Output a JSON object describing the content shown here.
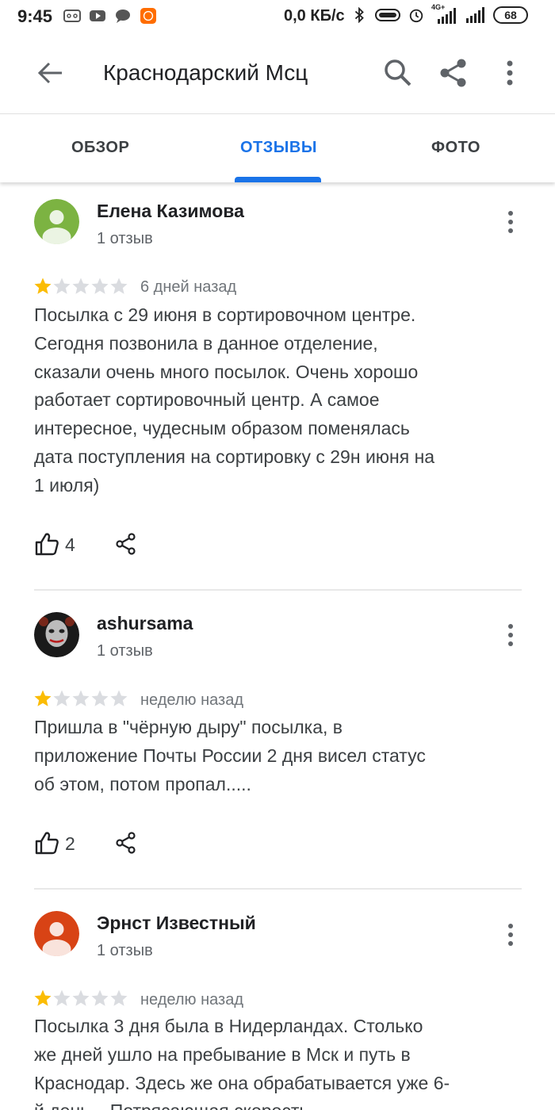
{
  "status_bar": {
    "time": "9:45",
    "speed": "0,0 КБ/с",
    "network": "4G+",
    "battery": "68",
    "icons": [
      "voicemail-icon",
      "youtube-icon",
      "chat-icon",
      "app-icon",
      "bluetooth-icon",
      "vibrate-icon",
      "alarm-icon",
      "signal-icon",
      "signal-icon",
      "battery-icon"
    ]
  },
  "app_bar": {
    "title": "Краснодарский Мсц",
    "icons": [
      "back-arrow-icon",
      "search-icon",
      "share-icon",
      "more-vert-icon"
    ]
  },
  "tabs": [
    {
      "label": "ОБЗОР",
      "active": false
    },
    {
      "label": "ОТЗЫВЫ",
      "active": true
    },
    {
      "label": "ФОТО",
      "active": false
    }
  ],
  "colors": {
    "accent": "#1a73e8",
    "star_filled": "#fbbc04",
    "star_empty": "#dadce0"
  },
  "reviews": [
    {
      "author": "Елена Казимова",
      "count": "1 отзыв",
      "rating": 1,
      "max_rating": 5,
      "date": "6 дней назад",
      "lines": [
        "Посылка с 29 июня в сортировочном центре.",
        "Сегодня позвонила в данное отделение,",
        "сказали очень много посылок. Очень хорошо",
        "работает сортировочный центр. А самое",
        "интересное, чудесным образом поменялась",
        "дата поступления на сортировку с 29н июня на",
        "1 июля)"
      ],
      "likes": "4",
      "avatar_color": "#7cb342"
    },
    {
      "author": "ashursama",
      "count": "1 отзыв",
      "rating": 1,
      "max_rating": 5,
      "date": "неделю назад",
      "lines": [
        "Пришла в \"чёрную дыру\" посылка, в",
        "приложение Почты России 2 дня висел статус",
        "об этом, потом пропал....."
      ],
      "likes": "2",
      "avatar_color": "#1a1a1a"
    },
    {
      "author": "Эрнст Известный",
      "count": "1 отзыв",
      "rating": 1,
      "max_rating": 5,
      "date": "неделю назад",
      "lines": [
        "Посылка 3 дня была в Нидерландах. Столько",
        "же дней ушло на пребывание в Мск и путь в",
        "Краснодар. Здесь же она обрабатывается уже 6-",
        "й день... Потрясающая скорость"
      ],
      "avatar_color": "#d84315"
    }
  ]
}
